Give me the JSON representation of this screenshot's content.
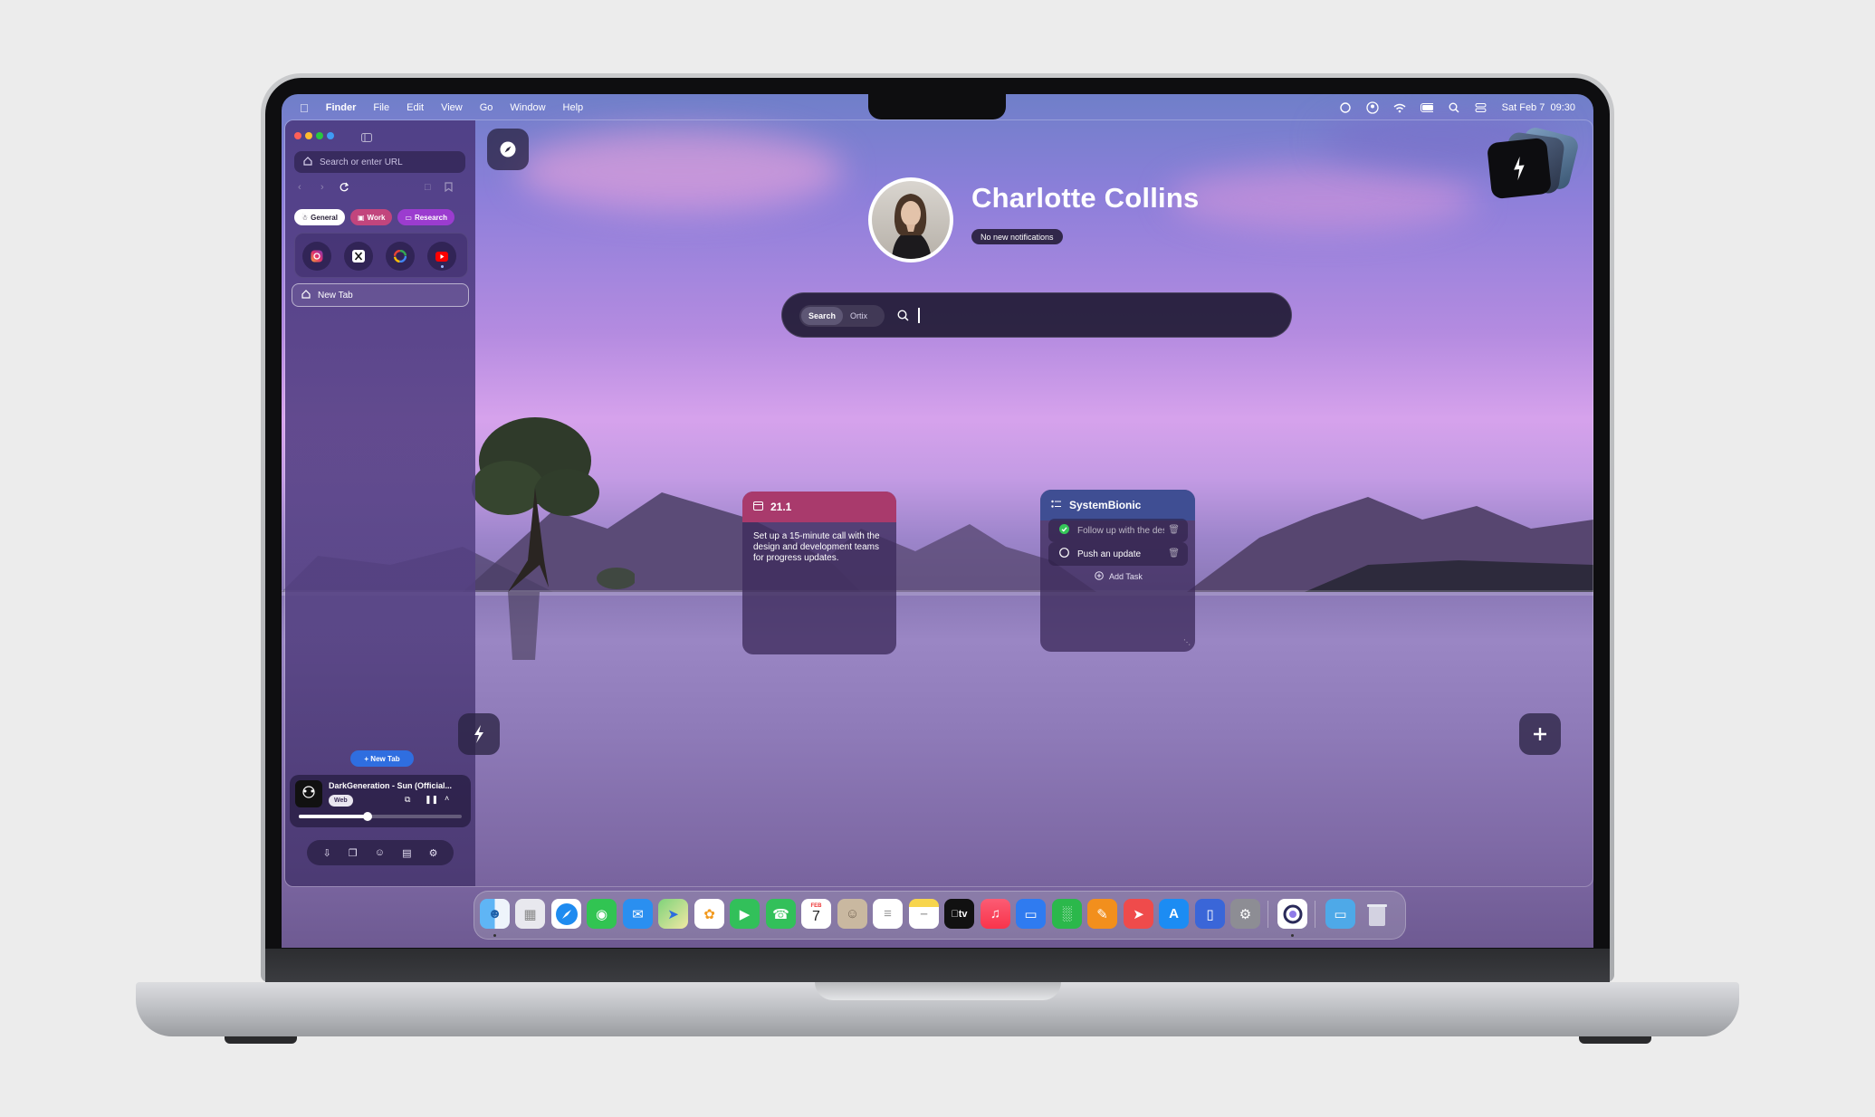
{
  "menubar": {
    "app": "Finder",
    "items": [
      "File",
      "Edit",
      "View",
      "Go",
      "Window",
      "Help"
    ],
    "clock": "Sat Feb 7  09:30"
  },
  "sidebar": {
    "url_placeholder": "Search or enter URL",
    "spaces": [
      {
        "label": "General",
        "color": "#ffffff"
      },
      {
        "label": "Work",
        "color": "#c2457d"
      },
      {
        "label": "Research",
        "color": "#9b3ccf"
      }
    ],
    "pinned": [
      "instagram-icon",
      "x-icon",
      "google-icon",
      "youtube-icon"
    ],
    "tab": {
      "label": "New Tab"
    },
    "new_tab_button": "+ New Tab",
    "player": {
      "title": "DarkGeneration - Sun (Official...",
      "source": "Web",
      "progress": 0.42
    }
  },
  "profile": {
    "name": "Charlotte Collins",
    "notifications": "No new notifications"
  },
  "search": {
    "modes": [
      "Search",
      "Ortix"
    ],
    "active_mode": "Search",
    "value": ""
  },
  "note_card": {
    "title": "21.1",
    "body": "Set up a 15-minute call with the design and development teams for progress updates.",
    "header_color": "#a93a6c"
  },
  "tasks_card": {
    "title": "SystemBionic",
    "header_color": "#3f4e93",
    "tasks": [
      {
        "label": "Follow up with the design team",
        "done": true
      },
      {
        "label": "Push an update",
        "done": false
      }
    ],
    "add_label": "Add Task"
  },
  "dock": {
    "apps": [
      "finder",
      "launchpad",
      "safari",
      "messages",
      "mail",
      "maps",
      "photos",
      "facetime",
      "phone",
      "calendar",
      "contacts",
      "reminders",
      "notes",
      "tv",
      "music",
      "keynote",
      "numbers",
      "pages",
      "rocket",
      "app-store",
      "iphone-mirroring",
      "system-settings",
      "ortix",
      "downloads",
      "trash"
    ],
    "calendar_day": "7",
    "calendar_month": "FEB",
    "tv_label": "tv"
  }
}
